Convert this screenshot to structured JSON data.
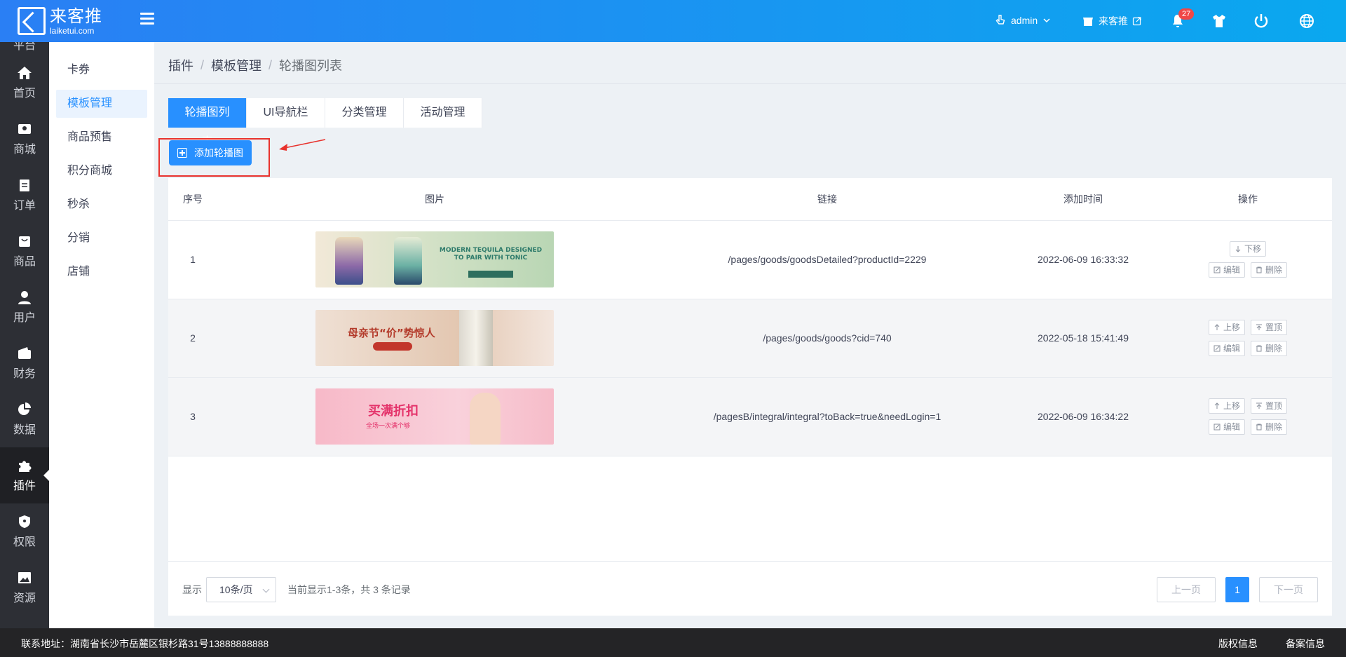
{
  "header": {
    "logo_cn": "来客推",
    "logo_en": "laiketui.com",
    "user_name": "admin",
    "shop_name": "来客推",
    "notification_count": "27"
  },
  "sidebar": {
    "top_partial_label": "平台",
    "items": [
      {
        "label": "首页",
        "icon": "home-icon"
      },
      {
        "label": "商城",
        "icon": "store-icon"
      },
      {
        "label": "订单",
        "icon": "clipboard-icon"
      },
      {
        "label": "商品",
        "icon": "bag-icon"
      },
      {
        "label": "用户",
        "icon": "user-icon"
      },
      {
        "label": "财务",
        "icon": "wallet-icon"
      },
      {
        "label": "数据",
        "icon": "pie-chart-icon"
      },
      {
        "label": "插件",
        "icon": "puzzle-icon",
        "active": true
      },
      {
        "label": "权限",
        "icon": "shield-icon"
      },
      {
        "label": "资源",
        "icon": "image-icon"
      }
    ]
  },
  "submenu": {
    "items": [
      "卡券",
      "模板管理",
      "商品预售",
      "积分商城",
      "秒杀",
      "分销",
      "店铺"
    ],
    "active_index": 1
  },
  "breadcrumb": [
    "插件",
    "模板管理",
    "轮播图列表"
  ],
  "tabs": [
    "轮播图列表",
    "UI导航栏",
    "分类管理",
    "活动管理"
  ],
  "add_button": "添加轮播图",
  "table": {
    "headers": [
      "序号",
      "图片",
      "链接",
      "添加时间",
      "操作"
    ],
    "rows": [
      {
        "no": "1",
        "banner_text": "MODERN TEQUILA DESIGNED TO PAIR WITH TONIC",
        "link": "/pages/goods/goodsDetailed?productId=2229",
        "time": "2022-06-09 16:33:32"
      },
      {
        "no": "2",
        "banner_text": "母亲节“价”势惊人",
        "link": "/pages/goods/goods?cid=740",
        "time": "2022-05-18 15:41:49"
      },
      {
        "no": "3",
        "banner_text": "买满折扣",
        "banner_subtext": "全场一次满个够",
        "link": "/pagesB/integral/integral?toBack=true&needLogin=1",
        "time": "2022-06-09 16:34:22"
      }
    ],
    "ops": {
      "move_down": "下移",
      "move_up": "上移",
      "pin_top": "置顶",
      "edit": "编辑",
      "delete": "删除"
    }
  },
  "pagination": {
    "show_label": "显示",
    "page_size": "10条/页",
    "summary": "当前显示1-3条，共 3 条记录",
    "prev": "上一页",
    "current": "1",
    "next": "下一页"
  },
  "footer": {
    "address": "联系地址：湖南省长沙市岳麓区银杉路31号13888888888",
    "copyright": "版权信息",
    "record": "备案信息"
  },
  "colors": {
    "primary": "#2890ff",
    "header_gradient_start": "#2a7ff4",
    "header_gradient_end": "#0aa8ef",
    "sidebar_bg": "#2d2f35",
    "highlight_red": "#e8322d"
  }
}
